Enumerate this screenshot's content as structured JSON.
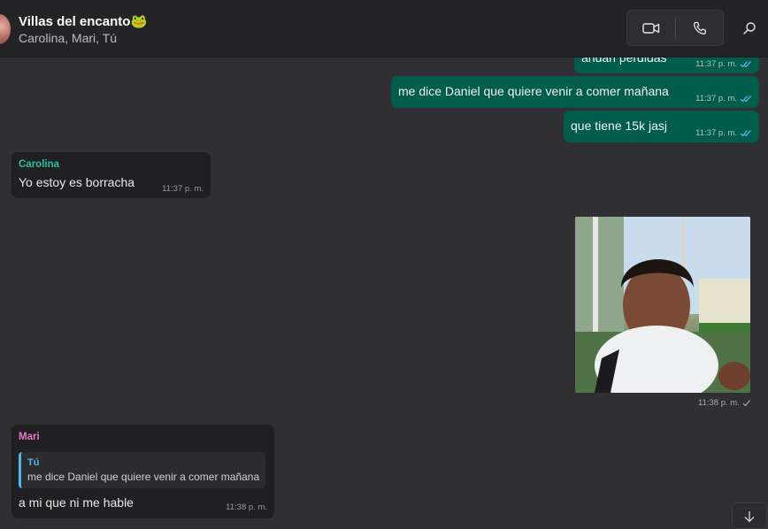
{
  "header": {
    "title": "Villas del encanto",
    "title_emoji": "🐸",
    "members": "Carolina, Mari, Tú",
    "icons": [
      "video-call-icon",
      "voice-call-icon",
      "search-icon"
    ]
  },
  "colors": {
    "outgoing_bubble": "#005c4b",
    "incoming_bubble": "#202022",
    "carolina_name": "#25c2a0",
    "mari_name": "#e879c5",
    "quote_accent": "#4fb6ec",
    "read_ticks": "#53bdeb"
  },
  "messages": [
    {
      "direction": "out",
      "text": "andan perdidas",
      "time": "11:37 p. m.",
      "status": "read"
    },
    {
      "direction": "out",
      "text": "me dice Daniel que quiere venir a comer mañana",
      "time": "11:37 p. m.",
      "status": "read"
    },
    {
      "direction": "out",
      "text": "que tiene 15k jasj",
      "time": "11:37 p. m.",
      "status": "read"
    },
    {
      "direction": "in",
      "sender": "Carolina",
      "text": "Yo estoy es borracha",
      "time": "11:37 p. m."
    },
    {
      "direction": "out",
      "type": "image",
      "image_alt": "photo-of-young-man-smiling",
      "time": "11:38 p. m.",
      "status": "sent"
    },
    {
      "direction": "in",
      "sender": "Mari",
      "quote": {
        "author": "Tú",
        "text": "me dice Daniel que quiere venir a comer mañana"
      },
      "text": "a mi que ni me hable",
      "time": "11:38 p. m."
    }
  ]
}
